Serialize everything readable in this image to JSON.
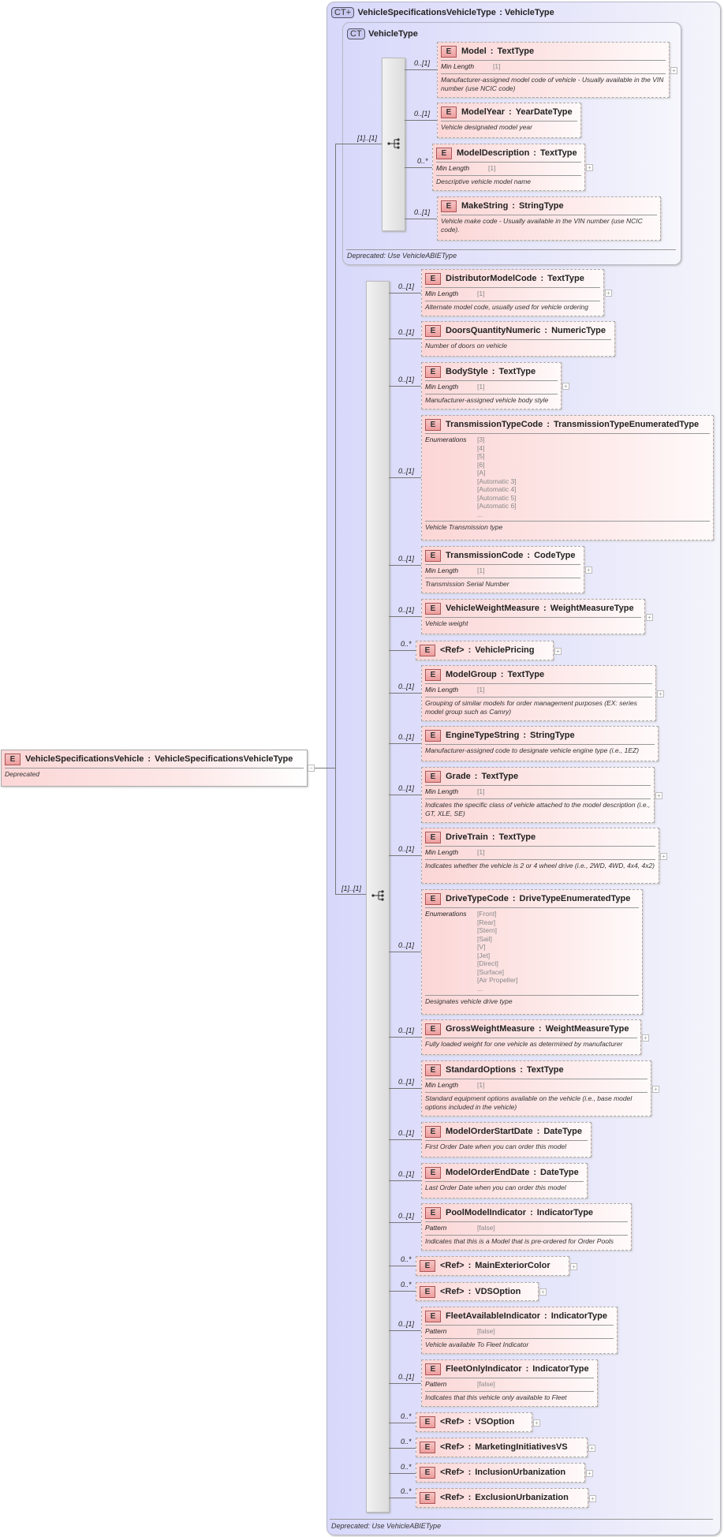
{
  "root": {
    "badge": "E",
    "name": "VehicleSpecificationsVehicle",
    "type": "VehicleSpecificationsVehicleType",
    "doc": "Deprecated",
    "collapse_icon": "minus"
  },
  "outer_type": {
    "badge": "CT+",
    "name": "VehicleSpecificationsVehicleType",
    "type": "VehicleType",
    "footer": "Deprecated: Use VehicleABIEType",
    "sequence_multiplicity": "[1]..[1]"
  },
  "vehicle_type": {
    "badge": "CT",
    "name": "VehicleType",
    "footer": "Deprecated: Use VehicleABIEType",
    "sequence_multiplicity": "[1]..[1]",
    "elements": [
      {
        "badge": "E",
        "name": "Model",
        "type": "TextType",
        "multiplicity": "0..[1]",
        "facet": {
          "label": "Min Length",
          "values": [
            "[1]"
          ]
        },
        "doc": "Manufacturer-assigned model code of vehicle - Usually available in the VIN number (use NCIC code)"
      },
      {
        "badge": "E",
        "name": "ModelYear",
        "type": "YearDateType",
        "multiplicity": "0..[1]",
        "doc": "Vehicle designated model year"
      },
      {
        "badge": "E",
        "name": "ModelDescription",
        "type": "TextType",
        "multiplicity": "0..*",
        "facet": {
          "label": "Min Length",
          "values": [
            "[1]"
          ]
        },
        "doc": "Descriptive vehicle model name"
      },
      {
        "badge": "E",
        "name": "MakeString",
        "type": "StringType",
        "multiplicity": "0..[1]",
        "doc": "Vehicle make code - Usually available in the VIN number (use NCIC code)."
      }
    ]
  },
  "sequence": {
    "elements": [
      {
        "badge": "E",
        "name": "DistributorModelCode",
        "type": "TextType",
        "multiplicity": "0..[1]",
        "facet": {
          "label": "Min Length",
          "values": [
            "[1]"
          ]
        },
        "doc": "Alternate model code, usually used for vehicle ordering"
      },
      {
        "badge": "E",
        "name": "DoorsQuantityNumeric",
        "type": "NumericType",
        "multiplicity": "0..[1]",
        "doc": "Number of doors on vehicle"
      },
      {
        "badge": "E",
        "name": "BodyStyle",
        "type": "TextType",
        "multiplicity": "0..[1]",
        "facet": {
          "label": "Min Length",
          "values": [
            "[1]"
          ]
        },
        "doc": "Manufacturer-assigned vehicle body style"
      },
      {
        "badge": "E",
        "name": "TransmissionTypeCode",
        "type": "TransmissionTypeEnumeratedType",
        "multiplicity": "0..[1]",
        "facet": {
          "label": "Enumerations",
          "values": [
            "[3]",
            "[4]",
            "[5]",
            "[6]",
            "[A]",
            "[Automatic 3]",
            "[Automatic 4]",
            "[Automatic 5]",
            "[Automatic 6]",
            "..."
          ]
        },
        "doc": "Vehicle Transmission type"
      },
      {
        "badge": "E",
        "name": "TransmissionCode",
        "type": "CodeType",
        "multiplicity": "0..[1]",
        "facet": {
          "label": "Min Length",
          "values": [
            "[1]"
          ]
        },
        "doc": "Transmission Serial Number"
      },
      {
        "badge": "E",
        "name": "VehicleWeightMeasure",
        "type": "WeightMeasureType",
        "multiplicity": "0..[1]",
        "doc": "Vehicle weight"
      },
      {
        "badge": "E",
        "name": "<Ref>",
        "type": "VehiclePricing",
        "multiplicity": "0..*"
      },
      {
        "badge": "E",
        "name": "ModelGroup",
        "type": "TextType",
        "multiplicity": "0..[1]",
        "facet": {
          "label": "Min Length",
          "values": [
            "[1]"
          ]
        },
        "doc": "Grouping of similar models for order management purposes (EX: series model group such as Camry)"
      },
      {
        "badge": "E",
        "name": "EngineTypeString",
        "type": "StringType",
        "multiplicity": "0..[1]",
        "doc": "Manufacturer-assigned code to designate vehicle engine type (i.e., 1EZ)"
      },
      {
        "badge": "E",
        "name": "Grade",
        "type": "TextType",
        "multiplicity": "0..[1]",
        "facet": {
          "label": "Min Length",
          "values": [
            "[1]"
          ]
        },
        "doc": "Indicates the specific class of vehicle attached to the model description (i.e., GT, XLE, SE)"
      },
      {
        "badge": "E",
        "name": "DriveTrain",
        "type": "TextType",
        "multiplicity": "0..[1]",
        "facet": {
          "label": "Min Length",
          "values": [
            "[1]"
          ]
        },
        "doc": "Indicates whether the vehicle is 2 or 4 wheel drive (i.e., 2WD, 4WD, 4x4, 4x2)"
      },
      {
        "badge": "E",
        "name": "DriveTypeCode",
        "type": "DriveTypeEnumeratedType",
        "multiplicity": "0..[1]",
        "facet": {
          "label": "Enumerations",
          "values": [
            "[Front]",
            "[Rear]",
            "[Stern]",
            "[Sail]",
            "[V]",
            "[Jet]",
            "[Direct]",
            "[Surface]",
            "[Air Propeller]",
            "..."
          ]
        },
        "doc": "Designates vehicle drive type"
      },
      {
        "badge": "E",
        "name": "GrossWeightMeasure",
        "type": "WeightMeasureType",
        "multiplicity": "0..[1]",
        "doc": "Fully loaded weight for one vehicle as determined by manufacturer"
      },
      {
        "badge": "E",
        "name": "StandardOptions",
        "type": "TextType",
        "multiplicity": "0..[1]",
        "facet": {
          "label": "Min Length",
          "values": [
            "[1]"
          ]
        },
        "doc": "Standard equipment options available on the vehicle (i.e., base model options included in the vehicle)"
      },
      {
        "badge": "E",
        "name": "ModelOrderStartDate",
        "type": "DateType",
        "multiplicity": "0..[1]",
        "doc": "First Order Date when you can order this model"
      },
      {
        "badge": "E",
        "name": "ModelOrderEndDate",
        "type": "DateType",
        "multiplicity": "0..[1]",
        "doc": "Last Order Date when you can order this model"
      },
      {
        "badge": "E",
        "name": "PoolModelIndicator",
        "type": "IndicatorType",
        "multiplicity": "0..[1]",
        "facet": {
          "label": "Pattern",
          "values": [
            "[false]"
          ]
        },
        "doc": "Indicates that this is a Model that is pre-ordered for Order Pools"
      },
      {
        "badge": "E",
        "name": "<Ref>",
        "type": "MainExteriorColor",
        "multiplicity": "0..*"
      },
      {
        "badge": "E",
        "name": "<Ref>",
        "type": "VDSOption",
        "multiplicity": "0..*"
      },
      {
        "badge": "E",
        "name": "FleetAvailableIndicator",
        "type": "IndicatorType",
        "multiplicity": "0..[1]",
        "facet": {
          "label": "Pattern",
          "values": [
            "[false]"
          ]
        },
        "doc": "Vehicle available To Fleet Indicator"
      },
      {
        "badge": "E",
        "name": "FleetOnlyIndicator",
        "type": "IndicatorType",
        "multiplicity": "0..[1]",
        "facet": {
          "label": "Pattern",
          "values": [
            "[false]"
          ]
        },
        "doc": "Indicates that this vehicle only available to Fleet"
      },
      {
        "badge": "E",
        "name": "<Ref>",
        "type": "VSOption",
        "multiplicity": "0..*"
      },
      {
        "badge": "E",
        "name": "<Ref>",
        "type": "MarketingInitiativesVS",
        "multiplicity": "0..*"
      },
      {
        "badge": "E",
        "name": "<Ref>",
        "type": "InclusionUrbanization",
        "multiplicity": "0..*"
      },
      {
        "badge": "E",
        "name": "<Ref>",
        "type": "ExclusionUrbanization",
        "multiplicity": "0..*"
      }
    ]
  }
}
